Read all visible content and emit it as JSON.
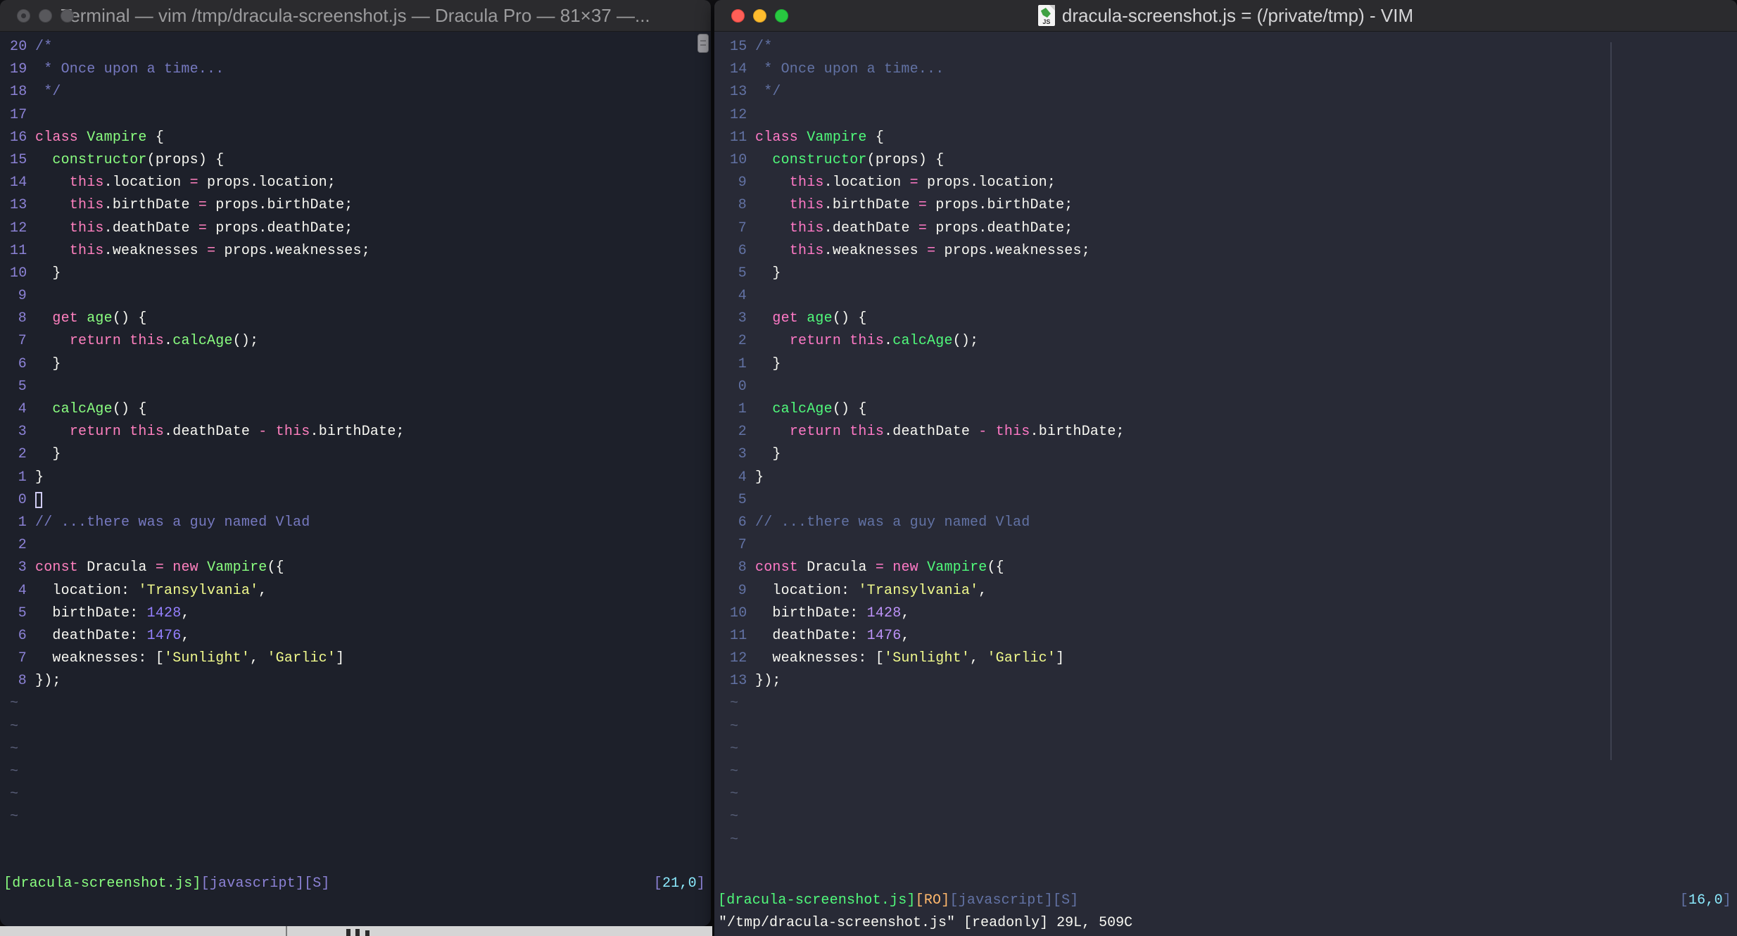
{
  "left_window": {
    "title": "Terminal — vim /tmp/dracula-screenshot.js — Dracula Pro — 81×37 —...",
    "theme_name": "Dracula Pro",
    "grid": "81×37",
    "numbers": [
      "20",
      "19",
      "18",
      "17",
      "16",
      "15",
      "14",
      "13",
      "12",
      "11",
      "10",
      "9",
      "8",
      "7",
      "6",
      "5",
      "4",
      "3",
      "2",
      "1",
      "0",
      "1",
      "2",
      "3",
      "4",
      "5",
      "6",
      "7",
      "8"
    ],
    "cursor_index": 20,
    "cursor": "hollow",
    "tilde_count": 6,
    "status": {
      "file": "[dracula-screenshot.js]",
      "filetype": "[javascript]",
      "flag": "[S]",
      "pos_open": "[",
      "pos": "21,0",
      "pos_close": "]"
    },
    "palette": {
      "bg": "#1d202a",
      "fg": "#f8f8f2",
      "com": "#7679c0",
      "num": "#8c82d6",
      "k": "#ff80bf",
      "g": "#8aff80",
      "y": "#f1fa8c",
      "n": "#9580ff",
      "cyan": "#8be9fd",
      "orange": "#ffca80",
      "tilde": "#5a5f7a"
    }
  },
  "right_window": {
    "title": "dracula-screenshot.js = (/private/tmp) - VIM",
    "icon_label": "JS",
    "numbers": [
      "15",
      "14",
      "13",
      "12",
      "11",
      "10",
      "9",
      "8",
      "7",
      "6",
      "5",
      "4",
      "3",
      "2",
      "1",
      "0",
      "1",
      "2",
      "3",
      "4",
      "5",
      "6",
      "7",
      "8",
      "9",
      "10",
      "11",
      "12",
      "13"
    ],
    "cursor_index": 15,
    "cursor": "none",
    "tilde_count": 7,
    "status": {
      "file": "[dracula-screenshot.js]",
      "readonly": "[RO]",
      "filetype": "[javascript]",
      "flag": "[S]",
      "pos_open": "[",
      "pos": "16,0",
      "pos_close": "]"
    },
    "message": "\"/tmp/dracula-screenshot.js\" [readonly] 29L, 509C",
    "palette": {
      "bg": "#282a36",
      "fg": "#f8f8f2",
      "com": "#6272a4",
      "num": "#6272a4",
      "k": "#ff79c6",
      "g": "#50fa7b",
      "y": "#f1fa8c",
      "n": "#bd93f9",
      "cyan": "#8be9fd",
      "orange": "#ffb86c",
      "tilde": "#565e78"
    }
  },
  "traffic_lights": {
    "inactive": "#58585c",
    "red": "#ff5f57",
    "yellow": "#febc2e",
    "green": "#28c840"
  },
  "code": {
    "language": "javascript",
    "total_lines": "29L",
    "total_chars": "509C",
    "lines": [
      [
        [
          "/*",
          "c"
        ]
      ],
      [
        [
          " * Once upon a time...",
          "c"
        ]
      ],
      [
        [
          " */",
          "c"
        ]
      ],
      [],
      [
        [
          "class",
          "k"
        ],
        [
          " ",
          "f"
        ],
        [
          "Vampire",
          "g"
        ],
        [
          " {",
          "f"
        ]
      ],
      [
        [
          "  ",
          "f"
        ],
        [
          "constructor",
          "g"
        ],
        [
          "(props) {",
          "f"
        ]
      ],
      [
        [
          "    ",
          "f"
        ],
        [
          "this",
          "k"
        ],
        [
          ".location ",
          "f"
        ],
        [
          "=",
          "k"
        ],
        [
          " props.location;",
          "f"
        ]
      ],
      [
        [
          "    ",
          "f"
        ],
        [
          "this",
          "k"
        ],
        [
          ".birthDate ",
          "f"
        ],
        [
          "=",
          "k"
        ],
        [
          " props.birthDate;",
          "f"
        ]
      ],
      [
        [
          "    ",
          "f"
        ],
        [
          "this",
          "k"
        ],
        [
          ".deathDate ",
          "f"
        ],
        [
          "=",
          "k"
        ],
        [
          " props.deathDate;",
          "f"
        ]
      ],
      [
        [
          "    ",
          "f"
        ],
        [
          "this",
          "k"
        ],
        [
          ".weaknesses ",
          "f"
        ],
        [
          "=",
          "k"
        ],
        [
          " props.weaknesses;",
          "f"
        ]
      ],
      [
        [
          "  }",
          "f"
        ]
      ],
      [],
      [
        [
          "  ",
          "f"
        ],
        [
          "get",
          "k"
        ],
        [
          " ",
          "f"
        ],
        [
          "age",
          "g"
        ],
        [
          "() {",
          "f"
        ]
      ],
      [
        [
          "    ",
          "f"
        ],
        [
          "return",
          "k"
        ],
        [
          " ",
          "f"
        ],
        [
          "this",
          "k"
        ],
        [
          ".",
          "f"
        ],
        [
          "calcAge",
          "g"
        ],
        [
          "();",
          "f"
        ]
      ],
      [
        [
          "  }",
          "f"
        ]
      ],
      [],
      [
        [
          "  ",
          "f"
        ],
        [
          "calcAge",
          "g"
        ],
        [
          "() {",
          "f"
        ]
      ],
      [
        [
          "    ",
          "f"
        ],
        [
          "return",
          "k"
        ],
        [
          " ",
          "f"
        ],
        [
          "this",
          "k"
        ],
        [
          ".deathDate ",
          "f"
        ],
        [
          "-",
          "k"
        ],
        [
          " ",
          "f"
        ],
        [
          "this",
          "k"
        ],
        [
          ".birthDate;",
          "f"
        ]
      ],
      [
        [
          "  }",
          "f"
        ]
      ],
      [
        [
          "}",
          "f"
        ]
      ],
      [],
      [
        [
          "// ...there was a guy named Vlad",
          "c"
        ]
      ],
      [],
      [
        [
          "const",
          "k"
        ],
        [
          " Dracula ",
          "f"
        ],
        [
          "=",
          "k"
        ],
        [
          " ",
          "f"
        ],
        [
          "new",
          "k"
        ],
        [
          " ",
          "f"
        ],
        [
          "Vampire",
          "g"
        ],
        [
          "({",
          "f"
        ]
      ],
      [
        [
          "  location: ",
          "f"
        ],
        [
          "'Transylvania'",
          "y"
        ],
        [
          ",",
          "f"
        ]
      ],
      [
        [
          "  birthDate: ",
          "f"
        ],
        [
          "1428",
          "n"
        ],
        [
          ",",
          "f"
        ]
      ],
      [
        [
          "  deathDate: ",
          "f"
        ],
        [
          "1476",
          "n"
        ],
        [
          ",",
          "f"
        ]
      ],
      [
        [
          "  weaknesses: [",
          "f"
        ],
        [
          "'Sunlight'",
          "y"
        ],
        [
          ", ",
          "f"
        ],
        [
          "'Garlic'",
          "y"
        ],
        [
          "]",
          "f"
        ]
      ],
      [
        [
          "});",
          "f"
        ]
      ]
    ]
  }
}
